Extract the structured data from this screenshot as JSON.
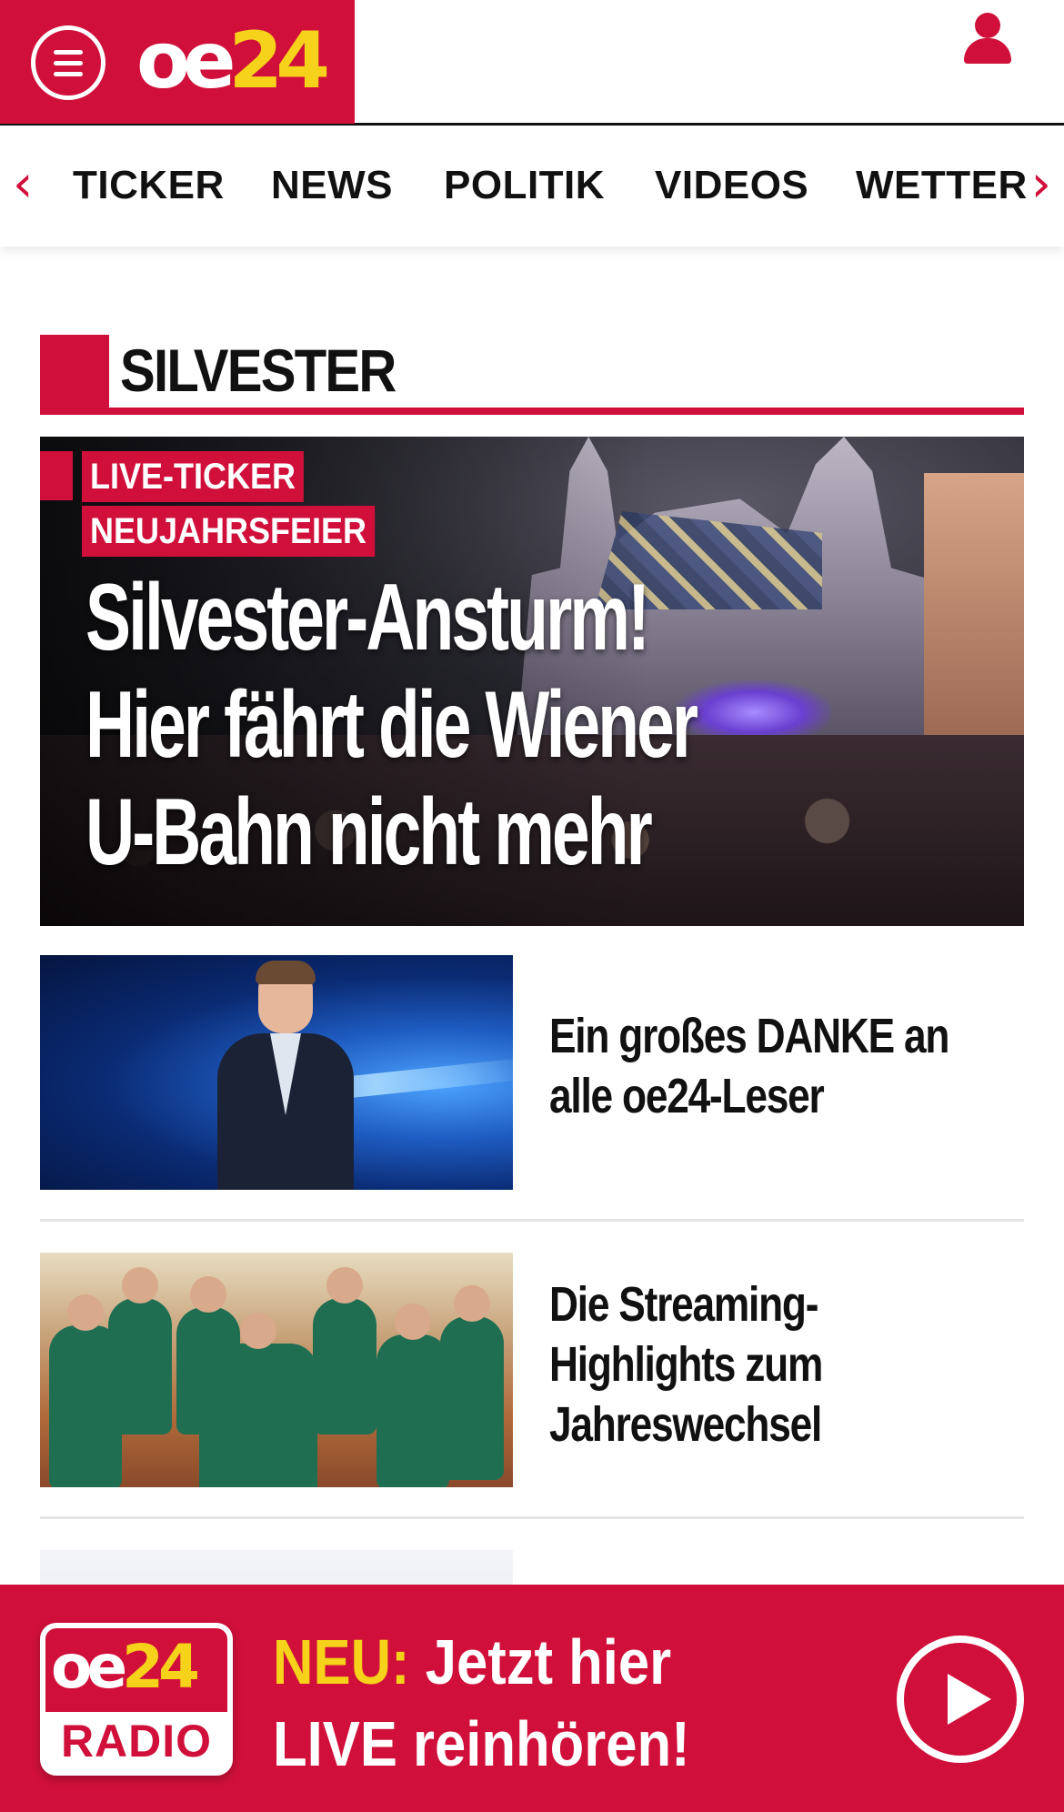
{
  "header": {
    "logo": {
      "part1": "oe",
      "part2": "24"
    },
    "menu_icon": "hamburger-menu-icon",
    "user_icon": "user-icon"
  },
  "nav": {
    "items": [
      "TICKER",
      "NEWS",
      "POLITIK",
      "VIDEOS",
      "WETTER"
    ],
    "prev_icon": "‹",
    "next_icon": "›"
  },
  "section": {
    "title": "SILVESTER"
  },
  "hero": {
    "tags": [
      "LIVE-TICKER",
      "NEUJAHRSFEIER"
    ],
    "title": "Silvester-Ansturm! Hier fährt die Wiener U-Bahn nicht mehr"
  },
  "articles": [
    {
      "title": "Ein großes DANKE an alle oe24-Leser"
    },
    {
      "title": "Die Streaming-Highlights zum Jahreswechsel"
    },
    {
      "title": ""
    }
  ],
  "radio_banner": {
    "logo_top": {
      "part1": "oe",
      "part2": "24"
    },
    "logo_bottom": "RADIO",
    "highlight": "NEU:",
    "line1": "Jetzt hier",
    "line2": "LIVE reinhören!",
    "play_icon": "play-icon"
  },
  "colors": {
    "brand_red": "#d0103a",
    "brand_yellow": "#f6d21a"
  }
}
